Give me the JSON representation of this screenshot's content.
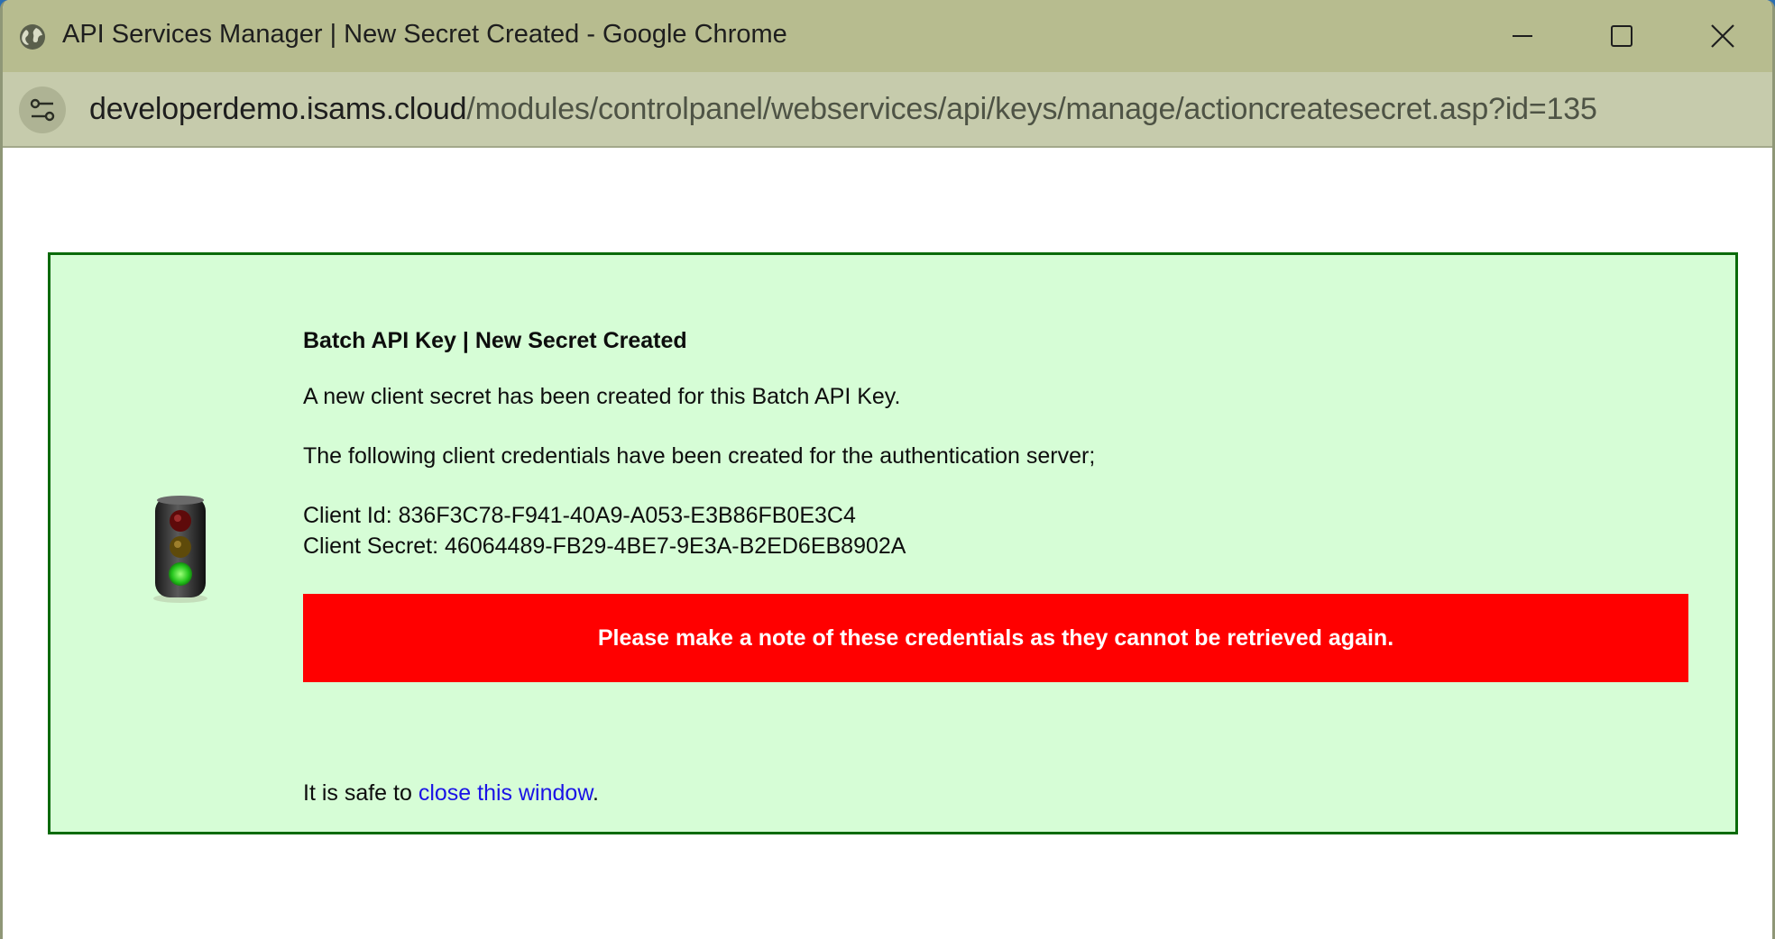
{
  "window": {
    "title": "API Services Manager | New Secret Created - Google Chrome"
  },
  "address_bar": {
    "host": "developerdemo.isams.cloud",
    "path": "/modules/controlpanel/webservices/api/keys/manage/actioncreatesecret.asp?id=135"
  },
  "message": {
    "heading": "Batch API Key | New Secret Created",
    "line1": "A new client secret has been created for this Batch API Key.",
    "line2": "The following client credentials have been created for the authentication server;",
    "client_id_label": "Client Id:",
    "client_id": "836F3C78-F941-40A9-A053-E3B86FB0E3C4",
    "client_secret_label": "Client Secret:",
    "client_secret": "46064489-FB29-4BE7-9E3A-B2ED6EB8902A",
    "warning": "Please make a note of these credentials as they cannot be retrieved again.",
    "safe_prefix": "It is safe to",
    "close_link": "close this window",
    "safe_suffix": "."
  },
  "colors": {
    "panel_background": "#d6fdd6",
    "panel_border": "#0a6a0a",
    "warning_background": "#ff0000",
    "link": "#1a12e6",
    "titlebar": "#b7bc8f"
  },
  "icons": {
    "title": "globe-icon",
    "site_info": "site-settings-icon",
    "status": "traffic-light-icon"
  }
}
